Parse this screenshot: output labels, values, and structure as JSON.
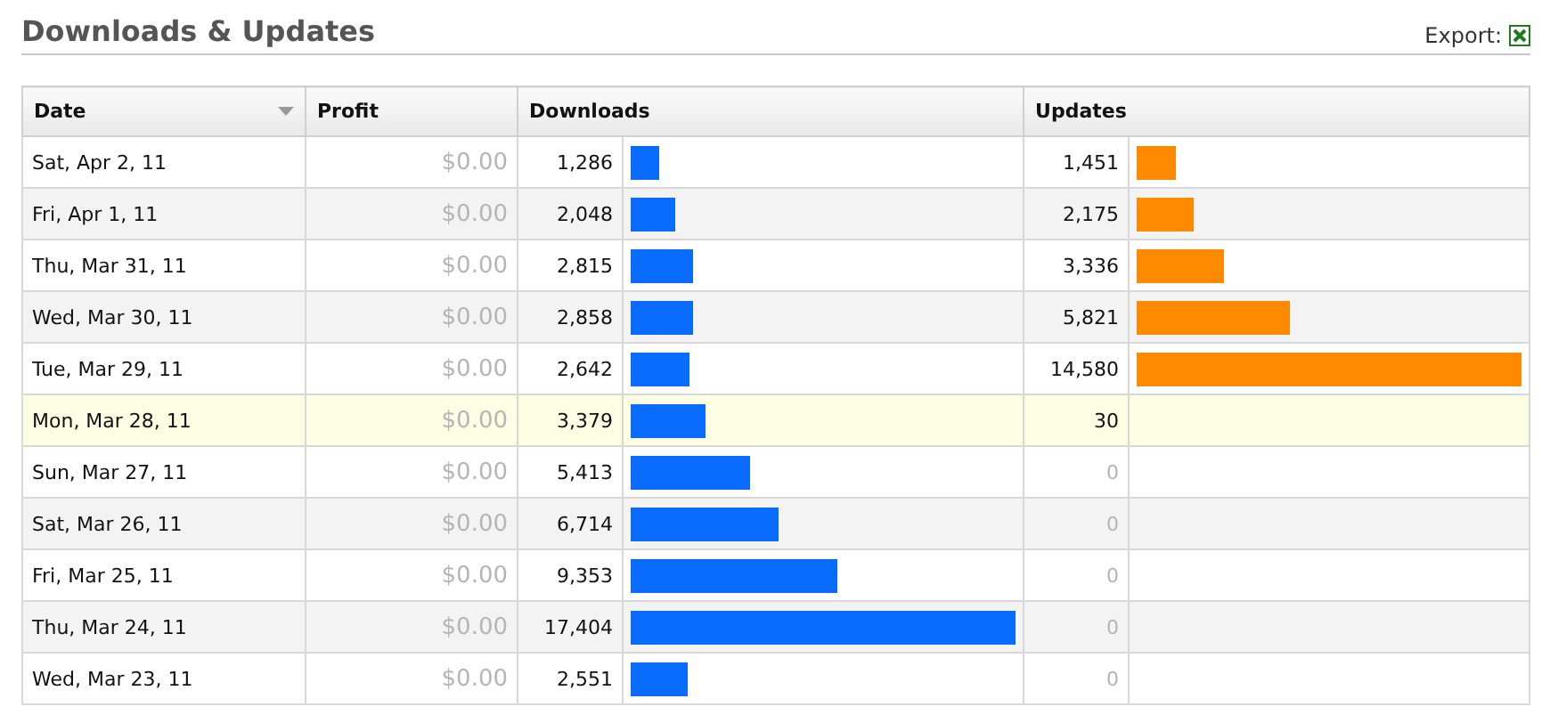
{
  "header": {
    "title": "Downloads & Updates",
    "export_label": "Export:"
  },
  "table": {
    "columns": [
      {
        "label": "Date",
        "sorted": true
      },
      {
        "label": "Profit",
        "sorted": false
      },
      {
        "label": "Downloads",
        "sorted": false
      },
      {
        "label": "Updates",
        "sorted": false
      }
    ],
    "rows": [
      {
        "date": "Sat, Apr 2, 11",
        "profit": "$0.00",
        "downloads": {
          "value": "1,286",
          "level": 0.074
        },
        "updates": {
          "value": "1,451",
          "level": 0.1,
          "dimmed": false
        },
        "highlighted": false
      },
      {
        "date": "Fri, Apr 1, 11",
        "profit": "$0.00",
        "downloads": {
          "value": "2,048",
          "level": 0.118
        },
        "updates": {
          "value": "2,175",
          "level": 0.149,
          "dimmed": false
        },
        "highlighted": false
      },
      {
        "date": "Thu, Mar 31, 11",
        "profit": "$0.00",
        "downloads": {
          "value": "2,815",
          "level": 0.162
        },
        "updates": {
          "value": "3,336",
          "level": 0.229,
          "dimmed": false
        },
        "highlighted": false
      },
      {
        "date": "Wed, Mar 30, 11",
        "profit": "$0.00",
        "downloads": {
          "value": "2,858",
          "level": 0.164
        },
        "updates": {
          "value": "5,821",
          "level": 0.399,
          "dimmed": false
        },
        "highlighted": false
      },
      {
        "date": "Tue, Mar 29, 11",
        "profit": "$0.00",
        "downloads": {
          "value": "2,642",
          "level": 0.152
        },
        "updates": {
          "value": "14,580",
          "level": 1,
          "dimmed": false
        },
        "highlighted": false
      },
      {
        "date": "Mon, Mar 28, 11",
        "profit": "$0.00",
        "downloads": {
          "value": "3,379",
          "level": 0.194
        },
        "updates": {
          "value": "30",
          "dimmed": false
        },
        "highlighted": true
      },
      {
        "date": "Sun, Mar 27, 11",
        "profit": "$0.00",
        "downloads": {
          "value": "5,413",
          "level": 0.311
        },
        "updates": {
          "value": "0",
          "dimmed": true
        },
        "highlighted": false
      },
      {
        "date": "Sat, Mar 26, 11",
        "profit": "$0.00",
        "downloads": {
          "value": "6,714",
          "level": 0.386
        },
        "updates": {
          "value": "0",
          "dimmed": true
        },
        "highlighted": false
      },
      {
        "date": "Fri, Mar 25, 11",
        "profit": "$0.00",
        "downloads": {
          "value": "9,353",
          "level": 0.537
        },
        "updates": {
          "value": "0",
          "dimmed": true
        },
        "highlighted": false
      },
      {
        "date": "Thu, Mar 24, 11",
        "profit": "$0.00",
        "downloads": {
          "value": "17,404",
          "level": 1
        },
        "updates": {
          "value": "0",
          "dimmed": true
        },
        "highlighted": false
      },
      {
        "date": "Wed, Mar 23, 11",
        "profit": "$0.00",
        "downloads": {
          "value": "2,551",
          "level": 0.147
        },
        "updates": {
          "value": "0",
          "dimmed": true
        },
        "highlighted": false
      }
    ]
  }
}
